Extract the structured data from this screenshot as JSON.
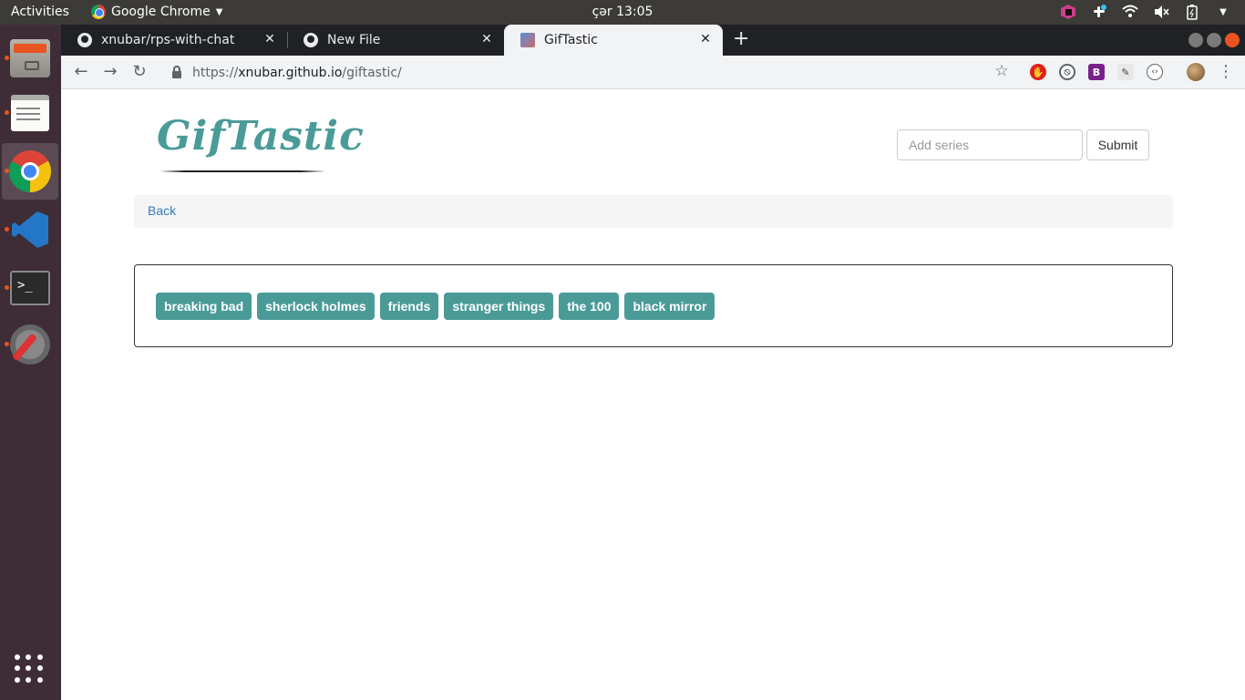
{
  "topbar": {
    "activities": "Activities",
    "app_name": "Google Chrome",
    "clock": "çər 13:05"
  },
  "dock": {
    "items": [
      "files-icon",
      "text-editor-icon",
      "chrome-icon",
      "vscode-icon",
      "terminal-icon",
      "system-tools-icon",
      "show-apps-icon"
    ]
  },
  "tabs": [
    {
      "title": "xnubar/rps-with-chat",
      "close": "✕"
    },
    {
      "title": "New File",
      "close": "✕"
    },
    {
      "title": "GifTastic",
      "close": "✕"
    }
  ],
  "new_tab": "+",
  "omnibox": {
    "scheme": "https://",
    "host": "xnubar.github.io",
    "path": "/giftastic/"
  },
  "nav": {
    "back": "←",
    "forward": "→",
    "reload": "↻",
    "star": "☆",
    "menu": "⋮"
  },
  "extensions": {
    "bootstrap_label": "B"
  },
  "page": {
    "logo": "GifTastic",
    "search": {
      "placeholder": "Add series",
      "value": ""
    },
    "submit_label": "Submit",
    "back_label": "Back",
    "series": [
      "breaking bad",
      "sherlock holmes",
      "friends",
      "stranger things",
      "the 100",
      "black mirror"
    ]
  },
  "colors": {
    "accent": "#4a9b98",
    "link": "#337ab7",
    "ubuntu_orange": "#e95420"
  }
}
